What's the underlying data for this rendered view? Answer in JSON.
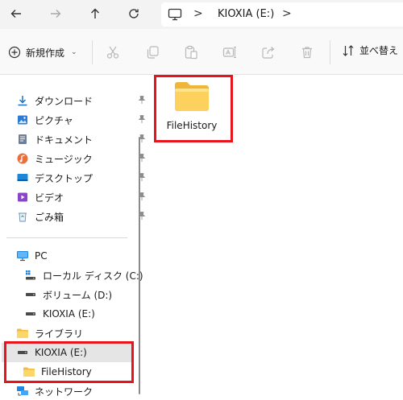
{
  "toolbar": {
    "back_icon": "arrow-left-icon",
    "forward_icon": "arrow-right-icon",
    "up_icon": "arrow-up-icon",
    "refresh_icon": "refresh-icon",
    "path_icon": "computer-icon",
    "breadcrumb": [
      "KIOXIA (E:)"
    ],
    "sep": ">"
  },
  "commands": {
    "new_label": "新規作成",
    "new_caret": "⌄",
    "tools": [
      "cut-icon",
      "copy-icon",
      "paste-icon",
      "rename-icon",
      "share-icon",
      "delete-icon"
    ],
    "sort_label": "並べ替え"
  },
  "sidebar": {
    "quick_access": [
      {
        "label": "ダウンロード",
        "icon": "download-icon",
        "pinned": true
      },
      {
        "label": "ピクチャ",
        "icon": "pictures-icon",
        "pinned": true
      },
      {
        "label": "ドキュメント",
        "icon": "documents-icon",
        "pinned": true
      },
      {
        "label": "ミュージック",
        "icon": "music-icon",
        "pinned": true
      },
      {
        "label": "デスクトップ",
        "icon": "desktop-icon",
        "pinned": true
      },
      {
        "label": "ビデオ",
        "icon": "video-icon",
        "pinned": true
      },
      {
        "label": "ごみ箱",
        "icon": "recycle-bin-icon",
        "pinned": true
      }
    ],
    "pc": {
      "label": "PC",
      "icon": "pc-icon"
    },
    "drives": [
      {
        "label": "ローカル ディスク (C:)",
        "icon": "local-disk-icon"
      },
      {
        "label": "ボリューム (D:)",
        "icon": "drive-icon"
      },
      {
        "label": "KIOXIA (E:)",
        "icon": "drive-icon"
      }
    ],
    "library": {
      "label": "ライブラリ",
      "icon": "library-folder-icon"
    },
    "selected_drive": {
      "label": "KIOXIA (E:)",
      "icon": "drive-icon"
    },
    "selected_child": {
      "label": "FileHistory",
      "icon": "folder-icon"
    },
    "network": {
      "label": "ネットワーク",
      "icon": "network-icon"
    }
  },
  "content": {
    "items": [
      {
        "name": "FileHistory",
        "icon": "folder-icon"
      }
    ]
  },
  "colors": {
    "highlight_box": "#e8141b",
    "folder": "#f7c948",
    "selected_bg": "#e5e5e5"
  }
}
